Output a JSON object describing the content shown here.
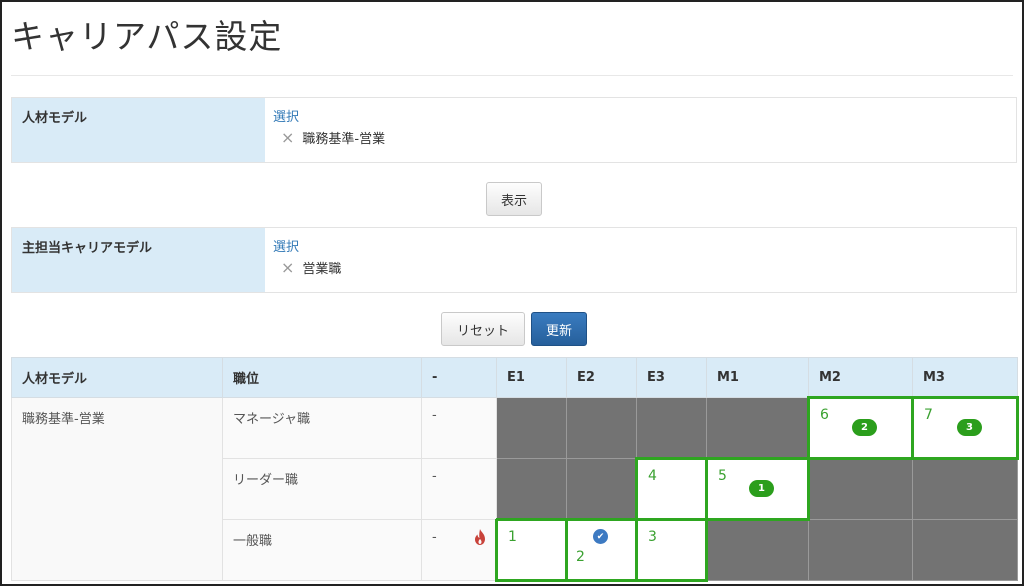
{
  "page": {
    "title": "キャリアパス設定"
  },
  "talent_model_field": {
    "label": "人材モデル",
    "select_link": "選択",
    "selected_value": "職務基準-営業",
    "remove_icon": "×"
  },
  "display_button": {
    "label": "表示"
  },
  "career_model_field": {
    "label": "主担当キャリアモデル",
    "select_link": "選択",
    "selected_value": "営業職",
    "remove_icon": "×"
  },
  "reset_button": {
    "label": "リセット"
  },
  "update_button": {
    "label": "更新"
  },
  "grid": {
    "headers": [
      "人材モデル",
      "職位",
      "-",
      "E1",
      "E2",
      "E3",
      "M1",
      "M2",
      "M3"
    ],
    "model_name": "職務基準-営業",
    "rows": [
      {
        "position": "マネージャ職",
        "dash": "-"
      },
      {
        "position": "リーダー職",
        "dash": "-"
      },
      {
        "position": "一般職",
        "dash": "-"
      }
    ],
    "cells": {
      "m2": {
        "number": "6",
        "badge": "2"
      },
      "m3": {
        "number": "7",
        "badge": "3"
      },
      "e3_leader": {
        "number": "4"
      },
      "m1_leader": {
        "number": "5",
        "badge": "1"
      },
      "e1_general": {
        "number": "1"
      },
      "e2_general": {
        "number": "2"
      },
      "e3_general": {
        "number": "3"
      }
    },
    "icons": {
      "check": "check-circle-icon",
      "fire": "fire-icon"
    },
    "colors": {
      "path_border": "#2ea620",
      "badge": "#2b9e1c",
      "dark_cell": "#737373",
      "header_bg": "#d9ebf7"
    }
  }
}
